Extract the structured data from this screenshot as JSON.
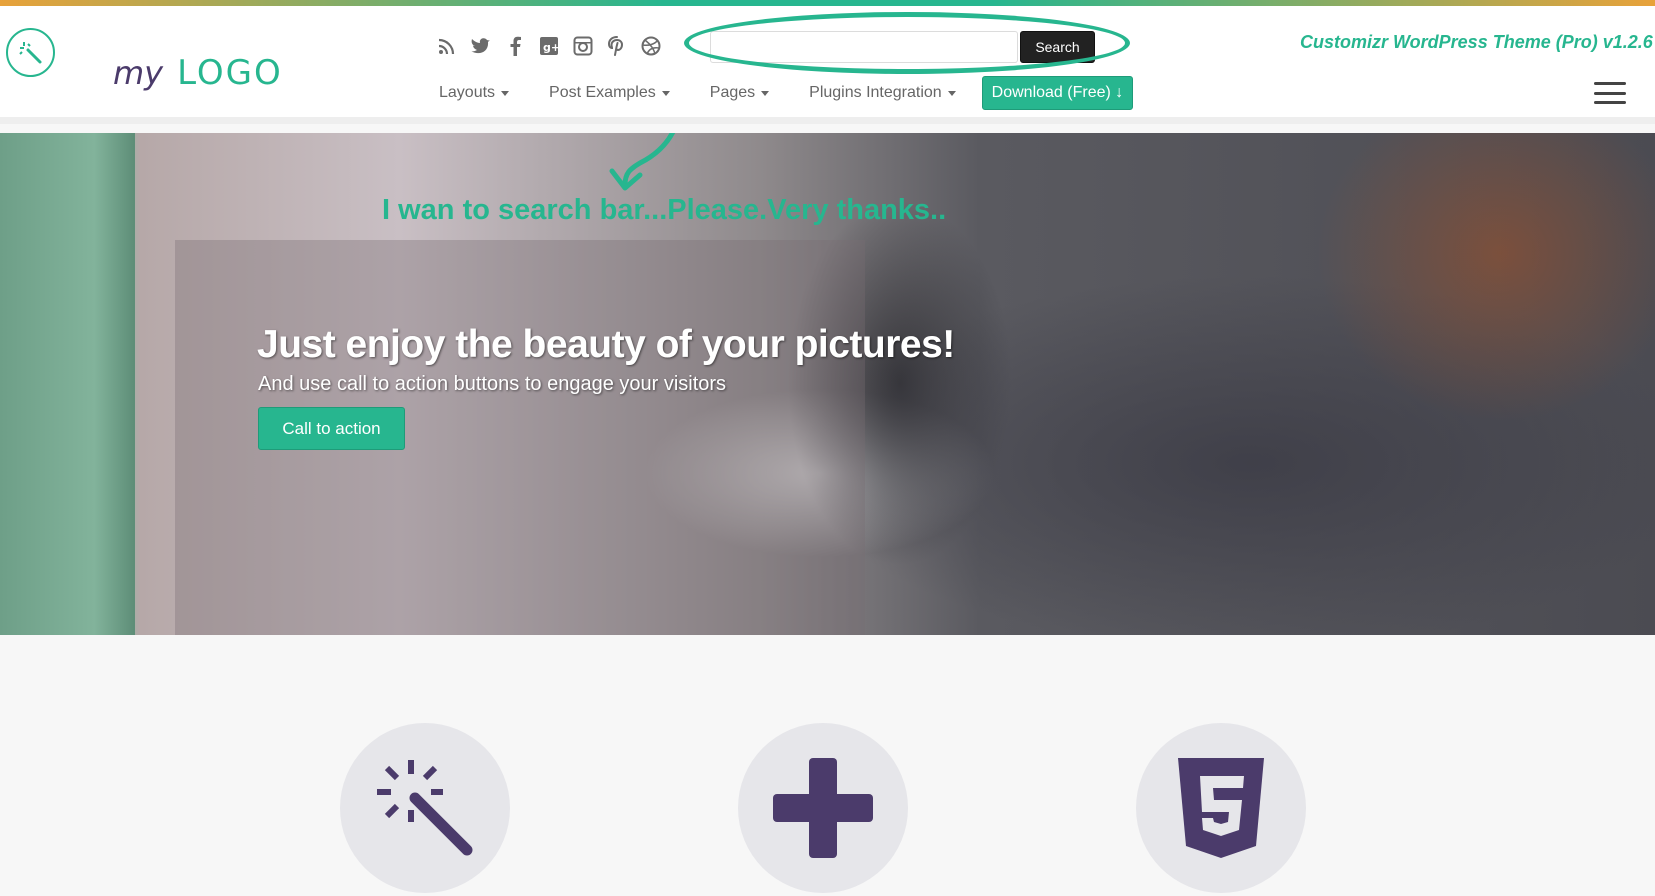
{
  "brand": {
    "logo_prefix": "my",
    "logo_text": "LOGO",
    "accent_color": "#27b68f",
    "logo_prefix_color": "#4b3b6b",
    "tagline": "Customizr WordPress Theme (Pro) v1.2.6"
  },
  "header": {
    "social_icons": [
      "rss-icon",
      "twitter-icon",
      "facebook-icon",
      "google-plus-icon",
      "instagram-icon",
      "pinterest-icon",
      "dribbble-icon"
    ],
    "search": {
      "placeholder": "",
      "value": "",
      "button_label": "Search"
    },
    "nav": {
      "items": [
        {
          "label": "Layouts",
          "has_dropdown": true
        },
        {
          "label": "Post Examples",
          "has_dropdown": true
        },
        {
          "label": "Pages",
          "has_dropdown": true
        },
        {
          "label": "Plugins Integration",
          "has_dropdown": true
        }
      ],
      "download_label": "Download (Free) ↓"
    }
  },
  "annotation": {
    "text": "I wan to search bar...Please.Very thanks..",
    "color": "#27b68f"
  },
  "hero": {
    "title": "Just enjoy the beauty of your pictures!",
    "subtitle": "And use call to action buttons to engage your visitors",
    "cta_label": "Call to action"
  },
  "features": {
    "icons": [
      "magic-wand-icon",
      "plus-icon",
      "html5-icon"
    ],
    "icon_color": "#4b3b6b"
  }
}
